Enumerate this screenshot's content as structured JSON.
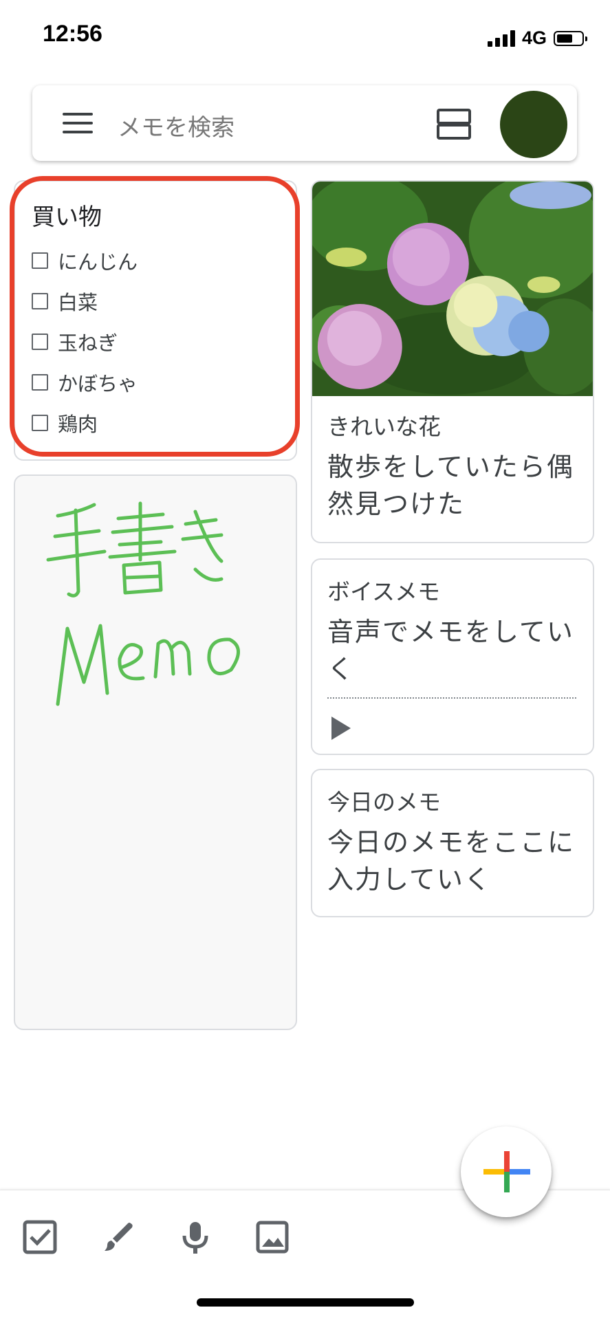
{
  "status_bar": {
    "time": "12:56",
    "network": "4G"
  },
  "search": {
    "placeholder": "メモを検索"
  },
  "shopping_note": {
    "title": "買い物",
    "items": [
      "にんじん",
      "白菜",
      "玉ねぎ",
      "かぼちゃ",
      "鶏肉"
    ]
  },
  "handwriting_note": {
    "line1": "手書き",
    "line2": "Memo",
    "ink_color": "#5cbf55"
  },
  "flower_note": {
    "title": "きれいな花",
    "body": "散歩をしていたら偶然見つけた"
  },
  "voice_note": {
    "title": "ボイスメモ",
    "body": "音声でメモをしていく"
  },
  "today_note": {
    "title": "今日のメモ",
    "body": "今日のメモをここに入力していく"
  },
  "colors": {
    "highlight": "#e8402b",
    "avatar": "#2b4516",
    "fab_red": "#ea4335",
    "fab_blue": "#4285f4",
    "fab_green": "#34a853",
    "fab_yellow": "#fbbc04"
  },
  "bottom_bar": {
    "icons": [
      "checkbox-icon",
      "brush-icon",
      "mic-icon",
      "image-icon"
    ]
  }
}
